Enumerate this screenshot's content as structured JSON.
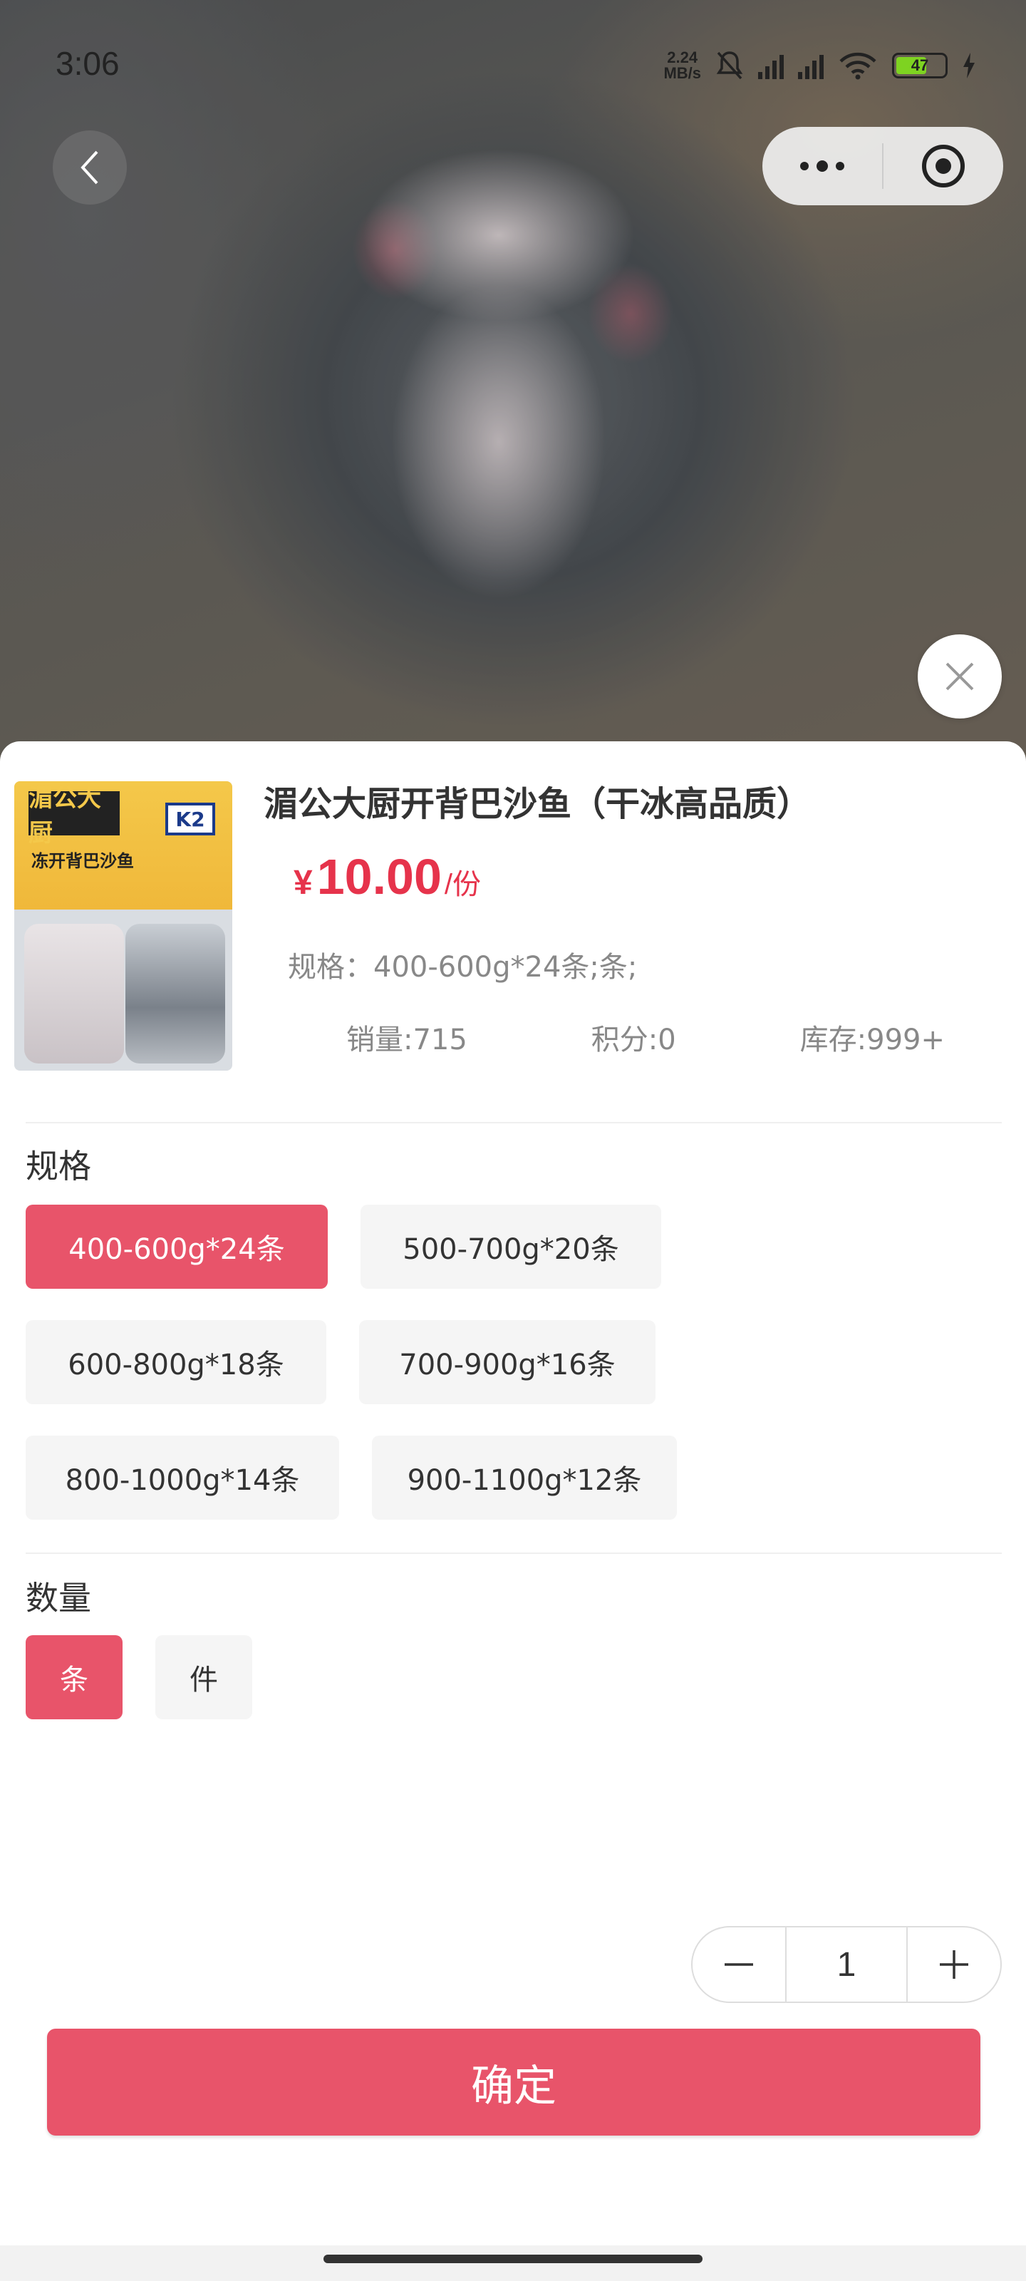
{
  "status_bar": {
    "time": "3:06",
    "net_speed_top": "2.24",
    "net_speed_bottom": "MB/s",
    "battery": "47"
  },
  "product": {
    "title": "湄公大厨开背巴沙鱼（干冰高品质）",
    "price_symbol": "¥",
    "price_value": "10.00",
    "price_unit": "/份",
    "spec_line": "规格：400-600g*24条;条;",
    "sales": "销量:715",
    "points": "积分:0",
    "stock": "库存:999+",
    "thumb_brand": "湄公大厨",
    "thumb_k2": "K2",
    "thumb_sub": "冻开背巴沙鱼"
  },
  "spec_section": {
    "label": "规格",
    "options": [
      "400-600g*24条",
      "500-700g*20条",
      "600-800g*18条",
      "700-900g*16条",
      "800-1000g*14条",
      "900-1100g*12条"
    ],
    "selected_index": 0
  },
  "qty_section": {
    "label": "数量",
    "options": [
      "条",
      "件"
    ],
    "selected_index": 0
  },
  "stepper": {
    "value": "1"
  },
  "confirm_label": "确定",
  "colors": {
    "accent": "#e8546a",
    "price": "#e6334b",
    "chip_bg": "#f5f5f5"
  }
}
